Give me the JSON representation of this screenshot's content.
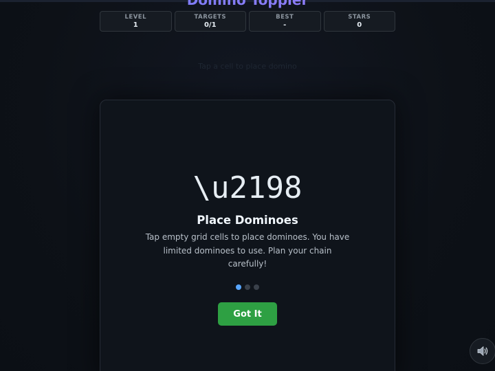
{
  "game": {
    "title": "Domino Toppler"
  },
  "stats": [
    {
      "label": "LEVEL",
      "value": "1"
    },
    {
      "label": "TARGETS",
      "value": "0/1"
    },
    {
      "label": "BEST",
      "value": "-"
    },
    {
      "label": "STARS",
      "value": "0"
    }
  ],
  "hint": "Tap a cell to place domino",
  "tutorial": {
    "icon_text": "\\u2198",
    "title": "Place Dominoes",
    "text": "Tap empty grid cells to place dominoes. You have limited dominoes to use. Plan your chain carefully!",
    "step": 1,
    "total_steps": 3,
    "button_label": "Got It"
  },
  "sound": {
    "icon": "speaker-icon",
    "enabled": true
  },
  "colors": {
    "background": "#0d1117",
    "accent": "#58a6ff",
    "button": "#2ea043",
    "title_gradient_start": "#6c7cf6",
    "title_gradient_end": "#a07cf6"
  }
}
